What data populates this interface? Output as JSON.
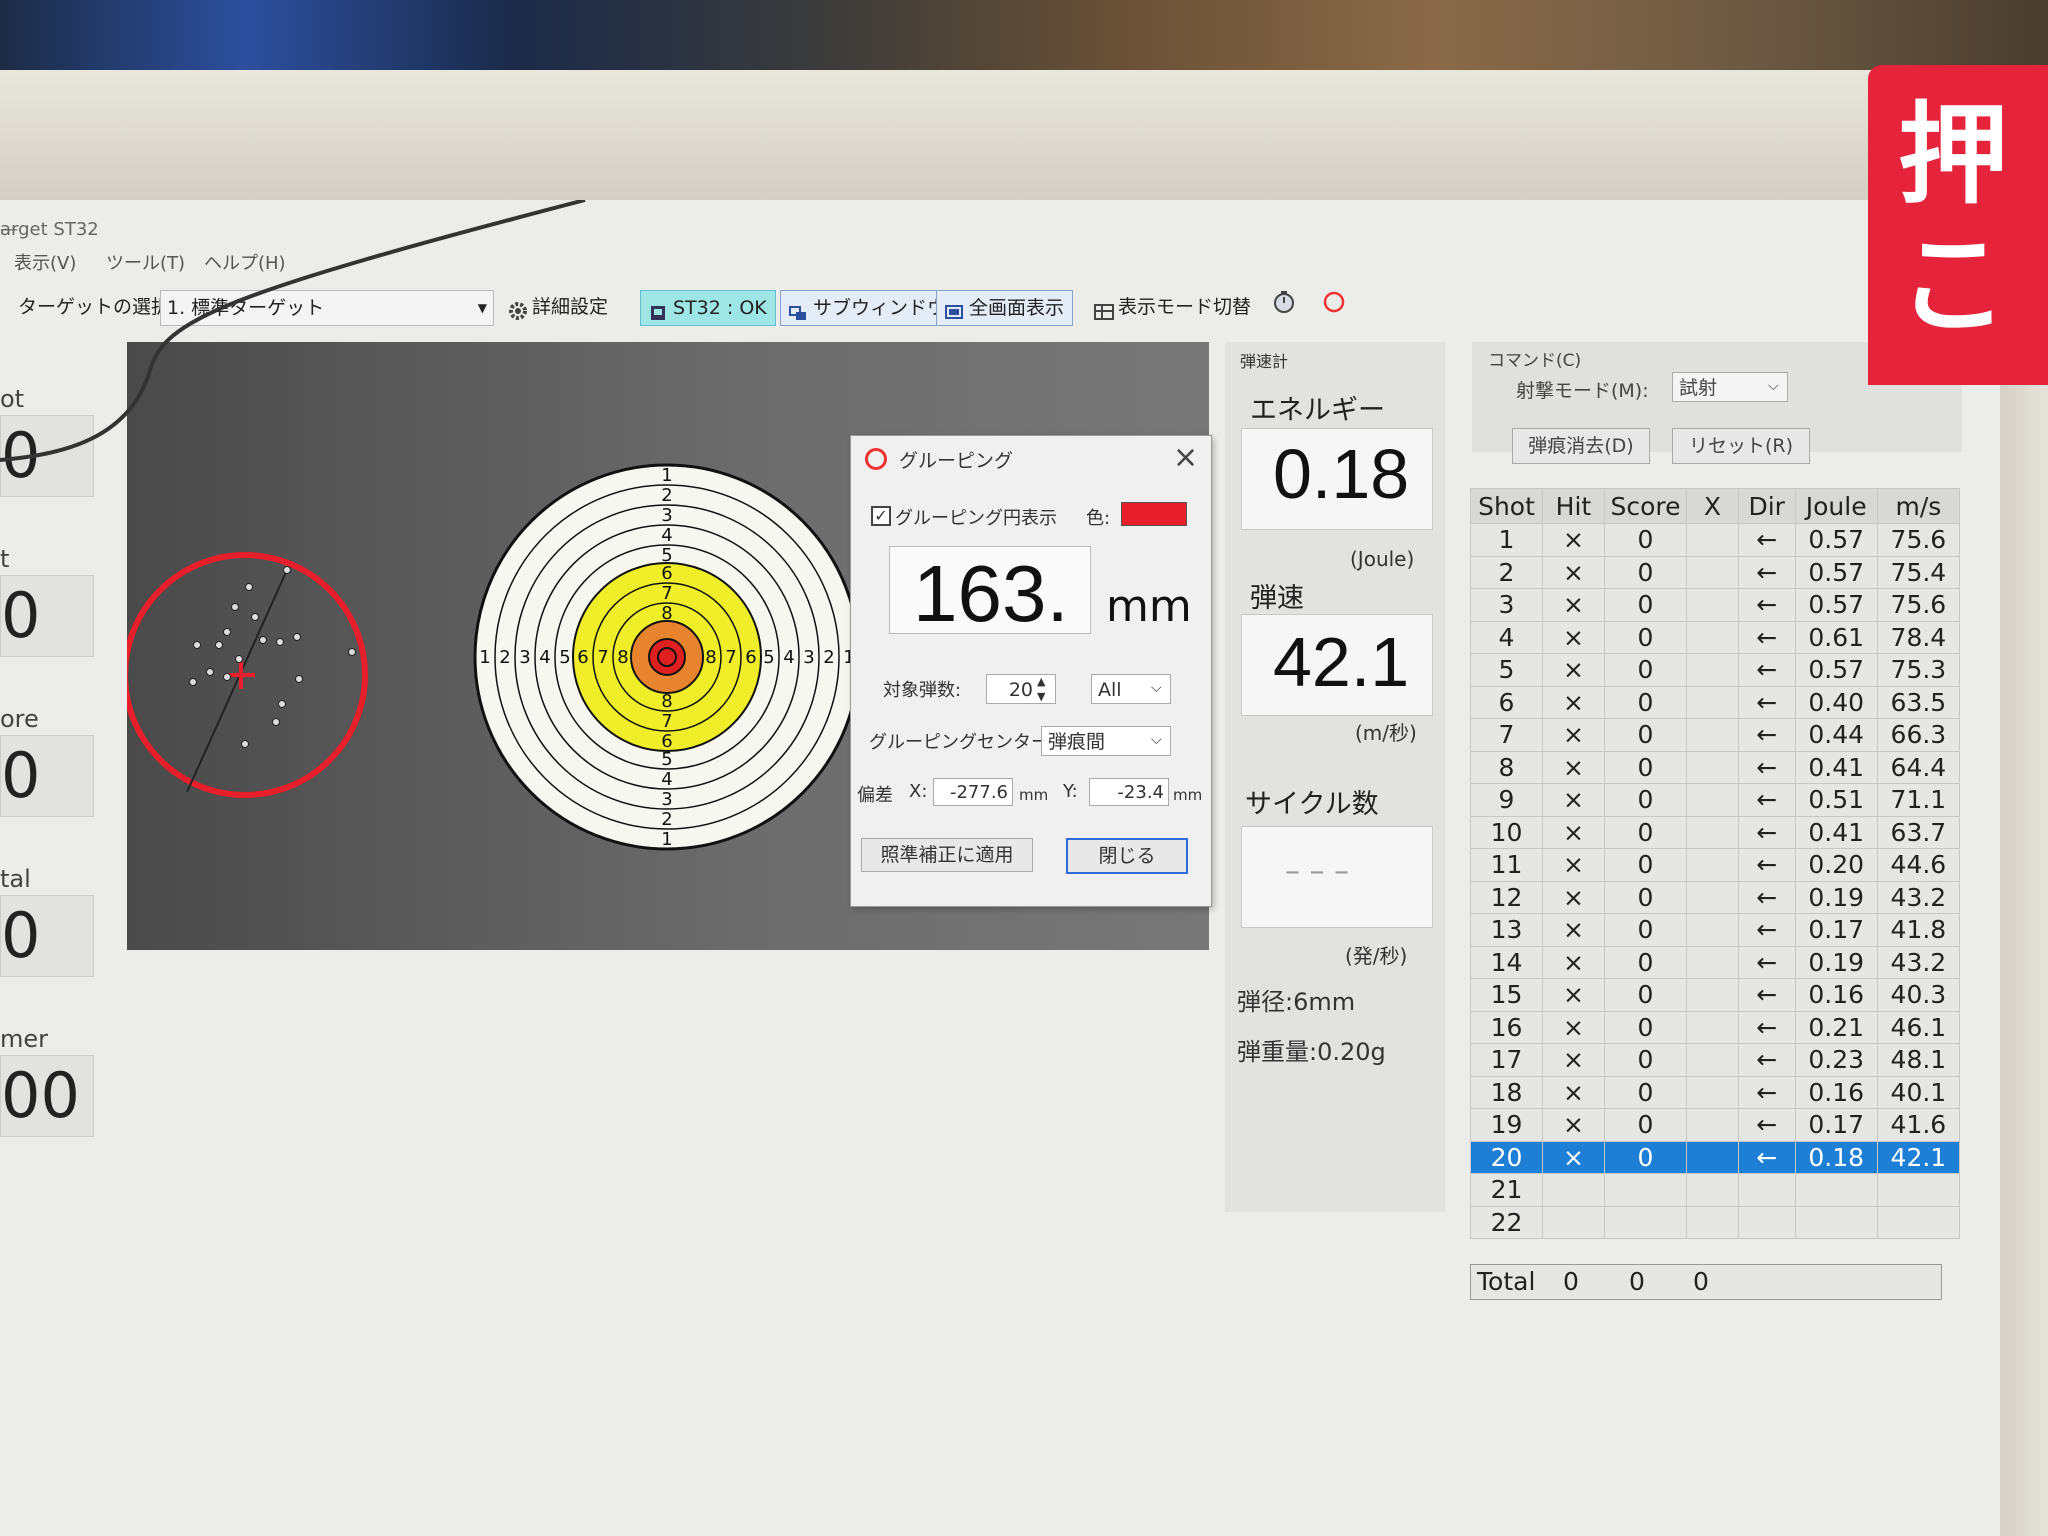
{
  "window": {
    "title": "arget ST32",
    "min_btn": "—"
  },
  "menu": [
    "表示(V)",
    "ツール(T)",
    "ヘルプ(H)"
  ],
  "toolbar": {
    "target_label": "ターゲットの選択:",
    "target_value": "1. 標準ターゲット",
    "detail_settings": "詳細設定",
    "status": "ST32 : OK",
    "subwindow": "サブウィンドウ",
    "fullscreen": "全画面表示",
    "display_mode": "表示モード切替"
  },
  "left_panel": {
    "labels": [
      "ot",
      "t",
      "ore",
      "tal",
      "mer"
    ],
    "values": [
      "0",
      "0",
      "0",
      "0",
      "00"
    ]
  },
  "target": {
    "ring_numbers_h": [
      "1",
      "2",
      "3",
      "4",
      "5",
      "6",
      "7",
      "8",
      "8",
      "7",
      "6",
      "5",
      "4",
      "3",
      "2",
      "1"
    ],
    "ring_numbers_v": [
      "1",
      "2",
      "3",
      "4",
      "5",
      "6",
      "7",
      "8",
      "8",
      "7",
      "6",
      "5",
      "4",
      "3",
      "2",
      "1"
    ],
    "colors": {
      "white": "#f7f7f2",
      "yellow": "#f0ee28",
      "orange": "#e8842d",
      "red": "#e02020",
      "grouping": "#e81e2a"
    }
  },
  "dialog": {
    "title": "グルーピング",
    "show_circle_label": "グルーピング円表示",
    "show_circle_checked": "✓",
    "color_label": "色:",
    "measure_value": "163.",
    "measure_unit": "mm",
    "target_shots_label": "対象弾数:",
    "target_shots_value": "20",
    "range_value": "All",
    "center_label": "グルーピングセンター:",
    "center_value": "弾痕間",
    "deviation_label": "偏差",
    "x_label": "X:",
    "x_value": "-277.6",
    "x_unit": "mm",
    "y_label": "Y:",
    "y_value": "-23.4",
    "y_unit": "mm",
    "apply_btn": "照準補正に適用",
    "close_btn": "閉じる"
  },
  "speed_panel": {
    "header": "弾速計",
    "energy_label": "エネルギー",
    "energy_value": "0.18",
    "energy_unit": "(Joule)",
    "speed_label": "弾速",
    "speed_value": "42.1",
    "speed_unit": "(m/秒)",
    "cycle_label": "サイクル数",
    "cycle_value": "– – –",
    "cycle_unit": "(発/秒)",
    "caliber": "弾径:6mm",
    "weight": "弾重量:0.20g"
  },
  "command": {
    "header": "コマンド(C)",
    "mode_label": "射撃モード(M):",
    "mode_value": "試射",
    "clear_btn": "弾痕消去(D)",
    "reset_btn": "リセット(R)"
  },
  "table": {
    "columns": [
      "Shot",
      "Hit",
      "Score",
      "X",
      "Dir",
      "Joule",
      "m/s"
    ],
    "rows": [
      [
        "1",
        "×",
        "0",
        "",
        "←",
        "0.57",
        "75.6"
      ],
      [
        "2",
        "×",
        "0",
        "",
        "←",
        "0.57",
        "75.4"
      ],
      [
        "3",
        "×",
        "0",
        "",
        "←",
        "0.57",
        "75.6"
      ],
      [
        "4",
        "×",
        "0",
        "",
        "←",
        "0.61",
        "78.4"
      ],
      [
        "5",
        "×",
        "0",
        "",
        "←",
        "0.57",
        "75.3"
      ],
      [
        "6",
        "×",
        "0",
        "",
        "←",
        "0.40",
        "63.5"
      ],
      [
        "7",
        "×",
        "0",
        "",
        "←",
        "0.44",
        "66.3"
      ],
      [
        "8",
        "×",
        "0",
        "",
        "←",
        "0.41",
        "64.4"
      ],
      [
        "9",
        "×",
        "0",
        "",
        "←",
        "0.51",
        "71.1"
      ],
      [
        "10",
        "×",
        "0",
        "",
        "←",
        "0.41",
        "63.7"
      ],
      [
        "11",
        "×",
        "0",
        "",
        "←",
        "0.20",
        "44.6"
      ],
      [
        "12",
        "×",
        "0",
        "",
        "←",
        "0.19",
        "43.2"
      ],
      [
        "13",
        "×",
        "0",
        "",
        "←",
        "0.17",
        "41.8"
      ],
      [
        "14",
        "×",
        "0",
        "",
        "←",
        "0.19",
        "43.2"
      ],
      [
        "15",
        "×",
        "0",
        "",
        "←",
        "0.16",
        "40.3"
      ],
      [
        "16",
        "×",
        "0",
        "",
        "←",
        "0.21",
        "46.1"
      ],
      [
        "17",
        "×",
        "0",
        "",
        "←",
        "0.23",
        "48.1"
      ],
      [
        "18",
        "×",
        "0",
        "",
        "←",
        "0.16",
        "40.1"
      ],
      [
        "19",
        "×",
        "0",
        "",
        "←",
        "0.17",
        "41.6"
      ],
      [
        "20",
        "×",
        "0",
        "",
        "←",
        "0.18",
        "42.1"
      ],
      [
        "21",
        "",
        "",
        "",
        "",
        "",
        ""
      ],
      [
        "22",
        "",
        "",
        "",
        "",
        "",
        ""
      ]
    ],
    "selected_shot": "20",
    "total": {
      "label": "Total",
      "hit": "0",
      "score": "0",
      "x": "0"
    }
  },
  "sign": {
    "line1": "押",
    "line2": "こ"
  }
}
